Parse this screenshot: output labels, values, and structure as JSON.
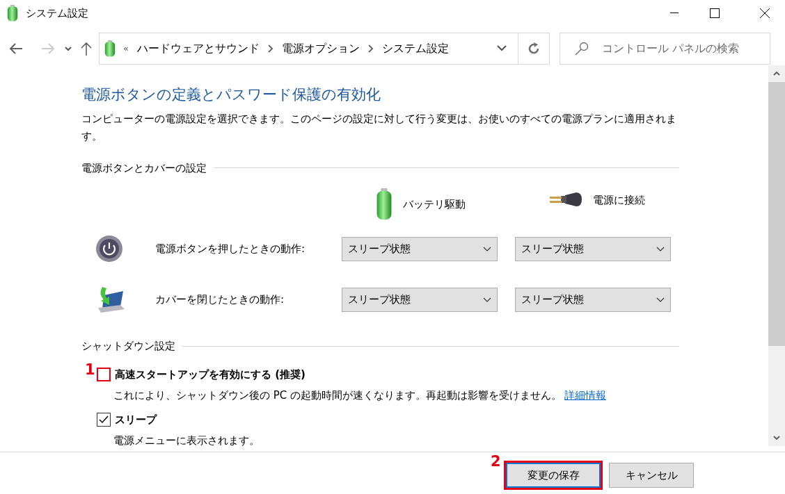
{
  "window": {
    "title": "システム設定"
  },
  "navigation": {
    "back_enabled": true,
    "forward_enabled": false
  },
  "address_bar": {
    "overflow_mark": "«",
    "crumbs": [
      "ハードウェアとサウンド",
      "電源オプション",
      "システム設定"
    ]
  },
  "search": {
    "placeholder": "コントロール パネルの検索"
  },
  "heading": "電源ボタンの定義とパスワード保護の有効化",
  "description": "コンピューターの電源設定を選択できます。このページの設定に対して行う変更は、お使いのすべての電源プランに適用されます。",
  "power_section": {
    "title": "電源ボタンとカバーの設定",
    "columns": [
      {
        "label": "バッテリ駆動",
        "kind": "battery"
      },
      {
        "label": "電源に接続",
        "kind": "plug"
      }
    ],
    "rows": [
      {
        "label": "電源ボタンを押したときの動作:",
        "kind": "power",
        "values": [
          "スリープ状態",
          "スリープ状態"
        ]
      },
      {
        "label": "カバーを閉じたときの動作:",
        "kind": "lid",
        "values": [
          "スリープ状態",
          "スリープ状態"
        ]
      }
    ]
  },
  "shutdown_section": {
    "title": "シャットダウン設定",
    "options": [
      {
        "label": "高速スタートアップを有効にする (推奨)",
        "checked": false,
        "callout": "1",
        "description": "これにより、シャットダウン後の PC の起動時間が速くなります。再起動は影響を受けません。",
        "link": "詳細情報"
      },
      {
        "label": "スリープ",
        "checked": true,
        "description": "電源メニューに表示されます。"
      }
    ]
  },
  "buttons": [
    {
      "label": "変更の保存",
      "kind": "primary",
      "callout": "2"
    },
    {
      "label": "キャンセル",
      "kind": "secondary"
    }
  ]
}
